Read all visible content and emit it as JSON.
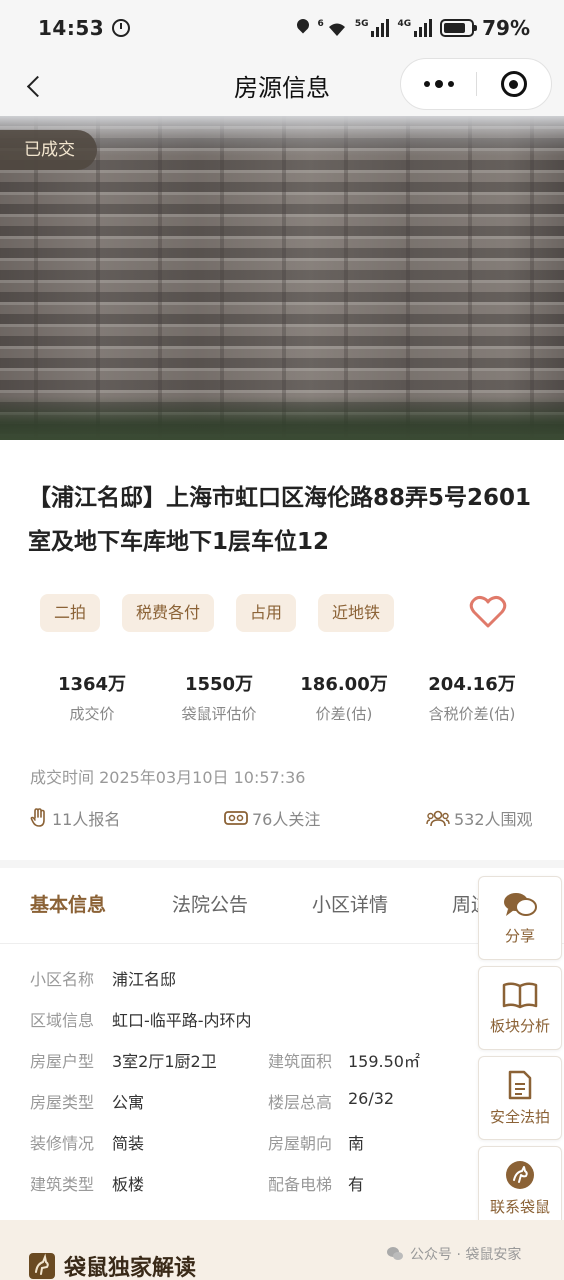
{
  "status_bar": {
    "time": "14:53",
    "battery": "79%",
    "net1": "6",
    "net2": "5G",
    "net3": "4G"
  },
  "nav": {
    "title": "房源信息"
  },
  "photo": {
    "badge": "已成交"
  },
  "listing": {
    "title": "【浦江名邸】上海市虹口区海伦路88弄5号2601室及地下车库地下1层车位12",
    "tags": [
      "二拍",
      "税费各付",
      "占用",
      "近地铁"
    ],
    "stats": [
      {
        "value": "1364万",
        "label": "成交价"
      },
      {
        "value": "1550万",
        "label": "袋鼠评估价"
      },
      {
        "value": "186.00万",
        "label": "价差(估)"
      },
      {
        "value": "204.16万",
        "label": "含税价差(估)"
      }
    ],
    "deal_time": "成交时间 2025年03月10日 10:57:36",
    "metrics": {
      "signups": "11人报名",
      "follows": "76人关注",
      "views": "532人围观"
    }
  },
  "tabs": [
    "基本信息",
    "法院公告",
    "小区详情",
    "周边"
  ],
  "basic_info": {
    "community_name_label": "小区名称",
    "community_name": "浦江名邸",
    "area_label": "区域信息",
    "area": "虹口-临平路-内环内",
    "layout_label": "房屋户型",
    "layout": "3室2厅1厨2卫",
    "build_area_label": "建筑面积",
    "build_area": "159.50㎡",
    "house_type_label": "房屋类型",
    "house_type": "公寓",
    "floor_label": "楼层总高",
    "floor": "26/32",
    "decoration_label": "装修情况",
    "decoration": "简装",
    "orientation_label": "房屋朝向",
    "orientation": "南",
    "building_type_label": "建筑类型",
    "building_type": "板楼",
    "elevator_label": "配备电梯",
    "elevator": "有"
  },
  "float_buttons": [
    "分享",
    "板块分析",
    "安全法拍",
    "联系袋鼠"
  ],
  "footer": {
    "section_title": "袋鼠独家解读",
    "watermark": "公众号 · 袋鼠安家"
  },
  "colors": {
    "accent": "#8b6236",
    "tag_bg": "#f7ede2",
    "heart": "#e07a6a"
  }
}
